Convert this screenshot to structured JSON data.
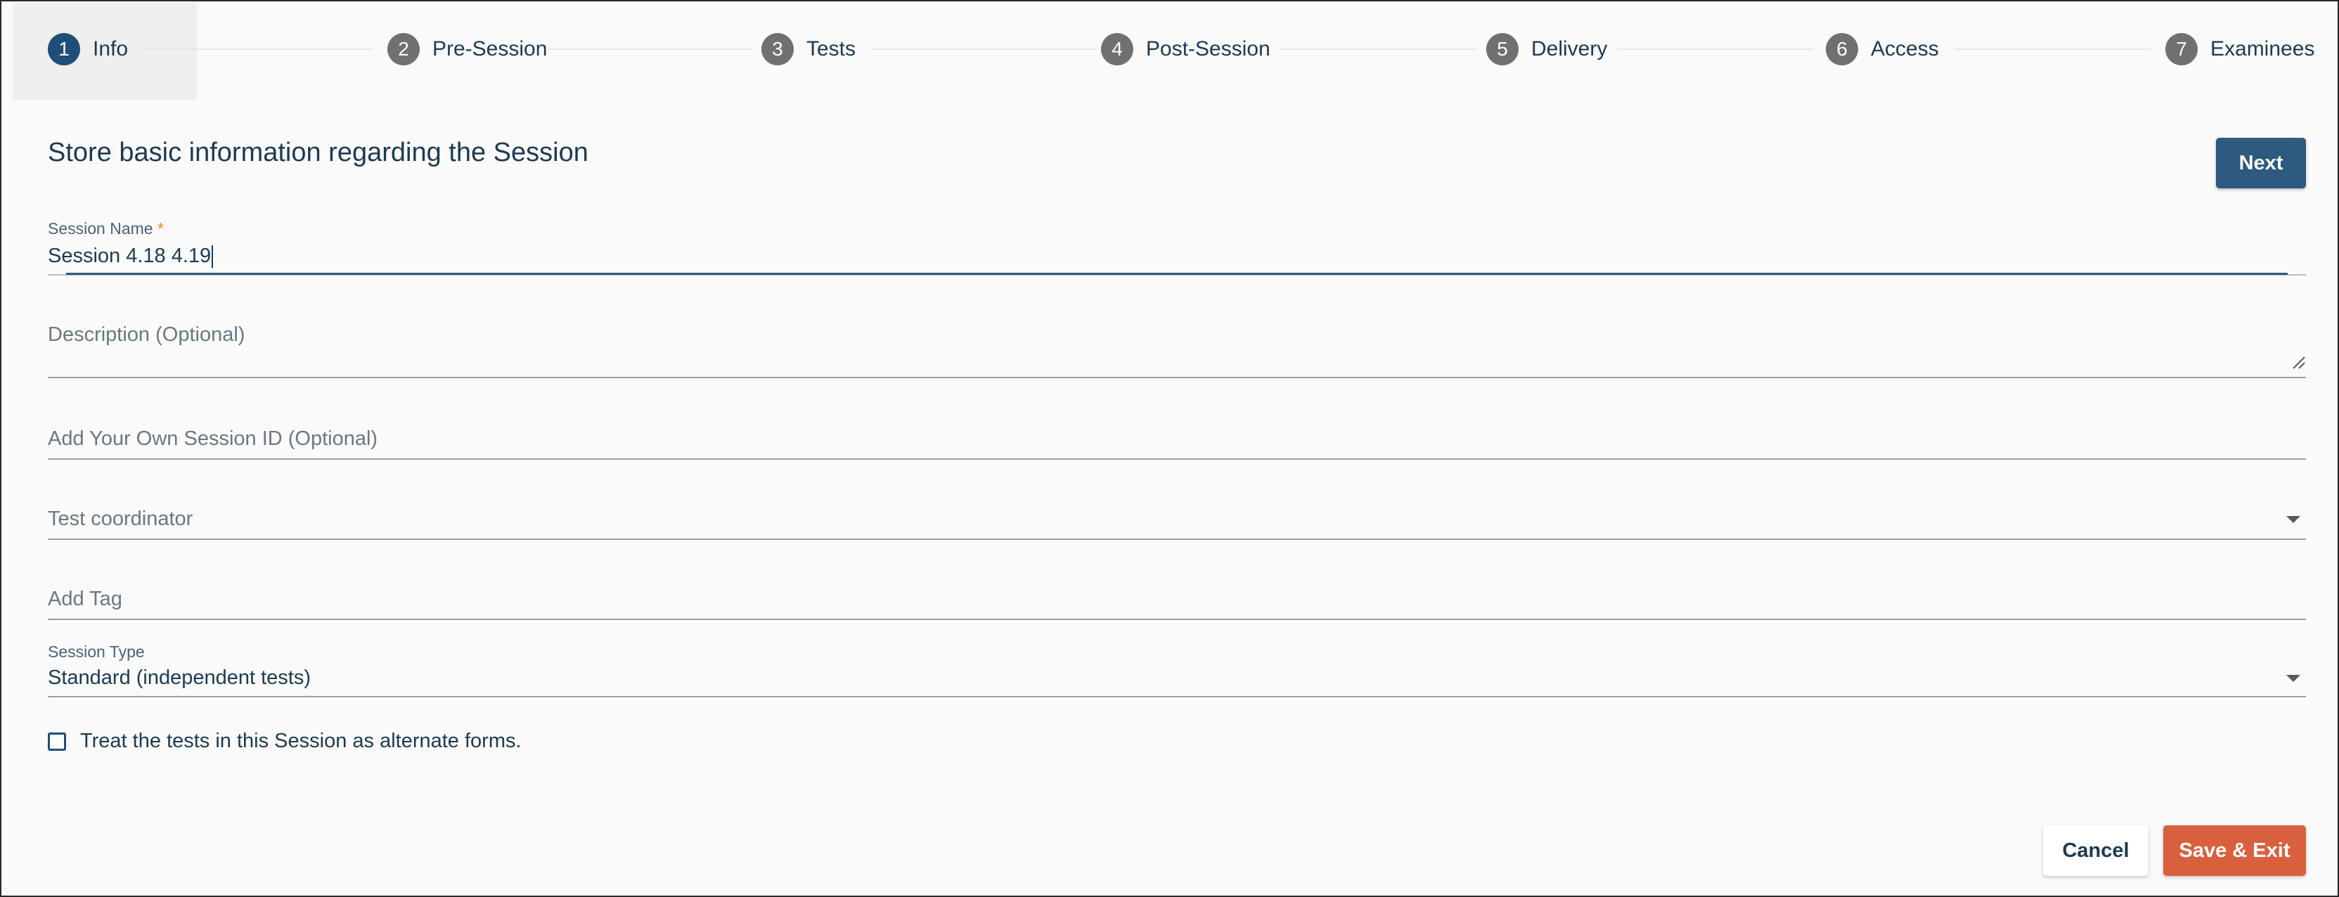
{
  "stepper": {
    "steps": [
      {
        "number": "1",
        "label": "Info"
      },
      {
        "number": "2",
        "label": "Pre-Session"
      },
      {
        "number": "3",
        "label": "Tests"
      },
      {
        "number": "4",
        "label": "Post-Session"
      },
      {
        "number": "5",
        "label": "Delivery"
      },
      {
        "number": "6",
        "label": "Access"
      },
      {
        "number": "7",
        "label": "Examinees"
      }
    ],
    "active_step": 1
  },
  "header": {
    "title": "Store basic information regarding the Session",
    "next_label": "Next"
  },
  "form": {
    "session_name": {
      "label": "Session Name",
      "required_mark": "*",
      "value": "Session 4.18 4.19"
    },
    "description": {
      "placeholder": "Description (Optional)"
    },
    "session_id": {
      "placeholder": "Add Your Own Session ID (Optional)"
    },
    "test_coordinator": {
      "placeholder": "Test coordinator"
    },
    "tag": {
      "placeholder": "Add Tag"
    },
    "session_type": {
      "label": "Session Type",
      "value": "Standard (independent tests)"
    },
    "alternate_forms": {
      "label": "Treat the tests in this Session as alternate forms.",
      "checked": false
    }
  },
  "footer": {
    "cancel_label": "Cancel",
    "save_exit_label": "Save & Exit"
  },
  "colors": {
    "primary": "#2d5a7e",
    "accent": "#d9603f",
    "active_step": "#1f4e79",
    "inactive_step": "#707070",
    "text": "#1d3a52"
  }
}
